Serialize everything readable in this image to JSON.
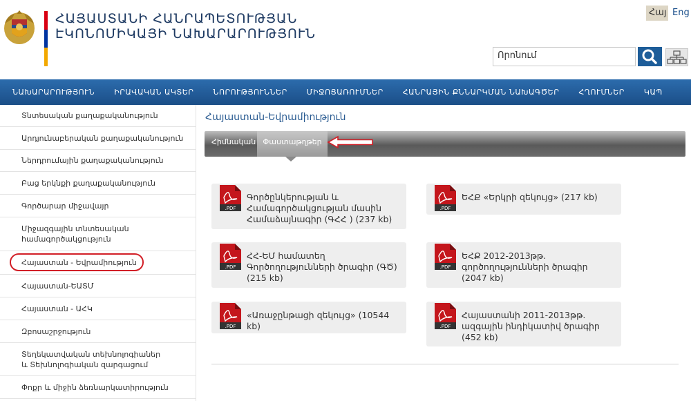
{
  "header": {
    "title_line1": "ՀԱՅԱՍՏԱՆԻ ՀԱՆՐԱՊԵՏՈՒԹՅԱՆ",
    "title_line2": "ԷԿՈՆՈՄԻԿԱՅԻ ՆԱԽԱՐԱՐՈՒԹՅՈՒՆ",
    "lang_active": "Հայ",
    "lang_other": "Eng",
    "search_placeholder": "Որոնում",
    "search_icon": "search-icon",
    "sitemap_icon": "sitemap-icon",
    "flag_colors": [
      "#d90012",
      "#0033a0",
      "#f2a800"
    ]
  },
  "nav": {
    "items": [
      "ՆԱԽԱՐԱՐՈՒԹՅՈՒՆ",
      "ԻՐԱՎԱԿԱՆ ԱԿՏԵՐ",
      "ՆՈՐՈՒԹՅՈՒՆՆԵՐ",
      "ՄԻՋՈՑԱՌՈՒՄՆԵՐ",
      "ՀԱՆՐԱՅԻՆ ՔՆՆԱՐԿՄԱՆ ՆԱԽԱԳԾԵՐ",
      "ՀՂՈՒՄՆԵՐ",
      "ԿԱՊ"
    ]
  },
  "sidebar": {
    "items": [
      "Տնտեսական քաղաքականություն",
      "Արդյունաբերական քաղաքականություն",
      "Ներդրումային քաղաքականություն",
      "Բաց երկնքի քաղաքականություն",
      "Գործարար միջավայր",
      "Միջազգային տնտեսական համագործակցություն",
      "Հայաստան - Եվրամիություն",
      "Հայաստան-ԵԱՏՄ",
      "Հայաստան - ԱՀԿ",
      "Զբոսաշրջություն",
      "Տեղեկատվական տեխնոլոգիաներ և Տեխնոլոգիական զարգացում",
      "Փոքր և միջին ձեռնարկատիրություն"
    ]
  },
  "main": {
    "page_title": "Հայաստան-Եվրամիություն",
    "tabs": [
      "Հիմնական",
      "Փաստաթղթեր"
    ],
    "documents": [
      "Գործընկերության և Համագործակցության մասին Համաձայնագիր (ԳՀՀ ) (237 kb)",
      "ԵՀՔ «Երկրի զեկույց» (217 kb)",
      "ՀՀ-ԵՄ համատեղ Գործողությունների ծրագիր (ԳԾ) (215 kb)",
      "ԵՀՔ 2012-2013թթ. գործողությունների ծրագիր (2047 kb)",
      "«Առաջընթացի զեկույց» (10544 kb)",
      "Հայաստանի 2011-2013թթ. ազգային ինդիկատիվ ծրագիր (452 kb)"
    ],
    "doc_icon": "pdf-icon",
    "pdf_label": ".PDF"
  }
}
